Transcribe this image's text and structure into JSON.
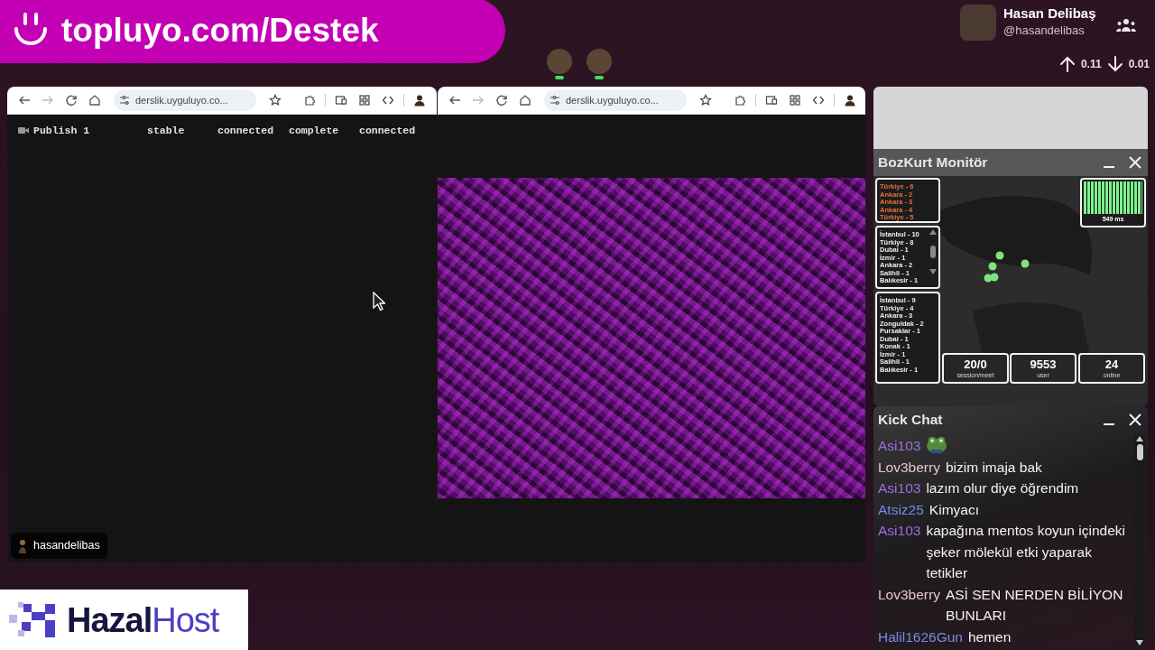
{
  "banner": {
    "text": "topluyo.com/Destek"
  },
  "viewers": [
    {
      "live": true
    },
    {
      "live": true
    }
  ],
  "profile": {
    "name": "Hasan Delibaş",
    "handle": "@hasandelibas",
    "upload": "0.11",
    "download": "0.01"
  },
  "browsers": [
    {
      "url": "derslik.uyguluyo.co...",
      "forward_disabled": true,
      "kind": "status-page",
      "status": [
        "Publish 1",
        "stable",
        "connected",
        "complete",
        "connected"
      ],
      "user_chip": "hasandelibas"
    },
    {
      "url": "derslik.uyguluyo.co...",
      "forward_disabled": true,
      "kind": "video-page"
    }
  ],
  "monitor": {
    "title": "BozKurt Monitör",
    "lists": [
      {
        "kind": "recent",
        "items": [
          "Türkiye - 6",
          "Ankara - 2",
          "Ankara - 3",
          "Ankara - 4",
          "Türkiye - 5"
        ]
      },
      {
        "kind": "scroll",
        "items": [
          "İstanbul - 10",
          "Türkiye - 8",
          "Dubai - 1",
          "İzmir - 1",
          "Ankara - 2",
          "Salihli - 1",
          "Balıkesir - 1"
        ]
      },
      {
        "kind": "plain",
        "items": [
          "İstanbul - 9",
          "Türkiye - 4",
          "Ankara - 3",
          "Zonguldak - 2",
          "Pursaklar - 1",
          "Dubai - 1",
          "Konak - 1",
          "İzmir - 1",
          "Salihli - 1",
          "Balıkesir - 1"
        ]
      }
    ],
    "latency": "549 ms",
    "stats": [
      {
        "value": "20/0",
        "label": "session/meet"
      },
      {
        "value": "9553",
        "label": "user"
      },
      {
        "value": "24",
        "label": "online"
      }
    ]
  },
  "chat": {
    "title": "Kick Chat",
    "messages": [
      {
        "kind": "emote",
        "user": "Asi103",
        "color": "#9d6fe0"
      },
      {
        "kind": "text",
        "user": "Lov3berry",
        "color": "#e6c3d3",
        "text": "bizim imaja bak"
      },
      {
        "kind": "text",
        "user": "Asi103",
        "color": "#9d6fe0",
        "text": "lazım olur diye öğrendim"
      },
      {
        "kind": "text",
        "user": "Atsiz25",
        "color": "#6f8fe6",
        "text": "Kimyacı"
      },
      {
        "kind": "text",
        "user": "Asi103",
        "color": "#9d6fe0",
        "text": "kapağına mentos koyun içindeki şeker mölekül etki yaparak tetikler"
      },
      {
        "kind": "text",
        "user": "Lov3berry",
        "color": "#e6c3d3",
        "text": "ASİ SEN NERDEN BİLİYON BUNLARI"
      },
      {
        "kind": "text",
        "user": "Halil1626Gun",
        "color": "#6f8fe6",
        "text": "hemen"
      }
    ]
  },
  "sponsor": {
    "name_main": "Hazal",
    "name_accent": "Host"
  }
}
